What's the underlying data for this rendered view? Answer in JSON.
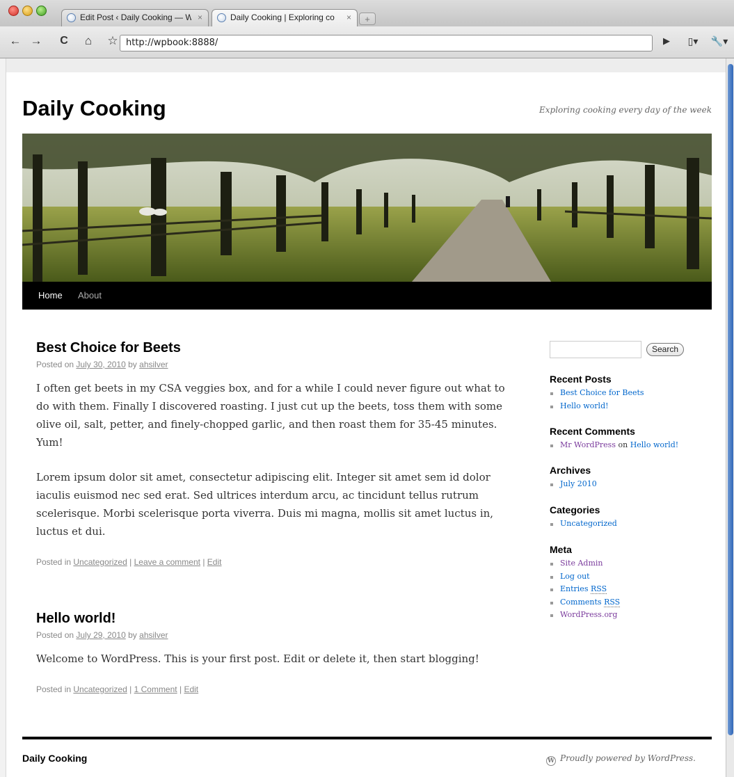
{
  "browser": {
    "tabs": [
      {
        "title": "Edit Post ‹ Daily Cooking — W",
        "close": "×",
        "active": false
      },
      {
        "title": "Daily Cooking | Exploring co",
        "close": "×",
        "active": true
      }
    ],
    "new_tab": "+",
    "url": "http://wpbook:8888/",
    "icons": {
      "back": "←",
      "forward": "→",
      "reload": "C",
      "home": "⌂",
      "bookmark": "☆",
      "go": "▶",
      "page_menu": "▯▾",
      "wrench_menu": "🔧▾"
    }
  },
  "site": {
    "title": "Daily Cooking",
    "description": "Exploring cooking every day of the week"
  },
  "nav": {
    "items": [
      {
        "label": "Home",
        "current": true
      },
      {
        "label": "About",
        "current": false
      }
    ]
  },
  "posts": [
    {
      "title": "Best Choice for Beets",
      "meta_prefix": "Posted on",
      "date": "July 30, 2010",
      "by": "by",
      "author": "ahsilver",
      "paragraphs": [
        "I often get beets in my CSA veggies box, and for a while I could never figure out what to do with them. Finally I discovered roasting. I just cut up the beets, toss them with some olive oil, salt, petter, and finely-chopped garlic, and then roast them for 35-45 minutes. Yum!",
        "Lorem ipsum dolor sit amet, consectetur adipiscing elit. Integer sit amet sem id dolor iaculis euismod nec sed erat. Sed ultrices interdum arcu, ac tincidunt tellus rutrum scelerisque. Morbi scelerisque porta viverra. Duis mi magna, mollis sit amet luctus in, luctus et dui."
      ],
      "posted_in": "Posted in",
      "category": "Uncategorized",
      "sep": "|",
      "comments": "Leave a comment",
      "edit": "Edit"
    },
    {
      "title": "Hello world!",
      "meta_prefix": "Posted on",
      "date": "July 29, 2010",
      "by": "by",
      "author": "ahsilver",
      "paragraphs": [
        "Welcome to WordPress. This is your first post. Edit or delete it, then start blogging!"
      ],
      "posted_in": "Posted in",
      "category": "Uncategorized",
      "sep": "|",
      "comments": "1 Comment",
      "edit": "Edit"
    }
  ],
  "sidebar": {
    "search_button": "Search",
    "search_value": "",
    "recent_posts": {
      "heading": "Recent Posts",
      "items": [
        "Best Choice for Beets",
        "Hello world!"
      ]
    },
    "recent_comments": {
      "heading": "Recent Comments",
      "author": "Mr WordPress",
      "on": "on",
      "post": "Hello world!"
    },
    "archives": {
      "heading": "Archives",
      "items": [
        "July 2010"
      ]
    },
    "categories": {
      "heading": "Categories",
      "items": [
        "Uncategorized"
      ]
    },
    "meta": {
      "heading": "Meta",
      "items": [
        "Site Admin",
        "Log out"
      ],
      "entries": "Entries",
      "comments": "Comments",
      "rss": "RSS",
      "wordpress_org": "WordPress.org"
    }
  },
  "footer": {
    "title": "Daily Cooking",
    "powered": "Proudly powered by WordPress."
  },
  "colors": {
    "nav_bg": "#000000",
    "link_blue": "#0066cc",
    "link_visited": "#7a3a9c",
    "scroll_thumb": "#2f66b8"
  }
}
